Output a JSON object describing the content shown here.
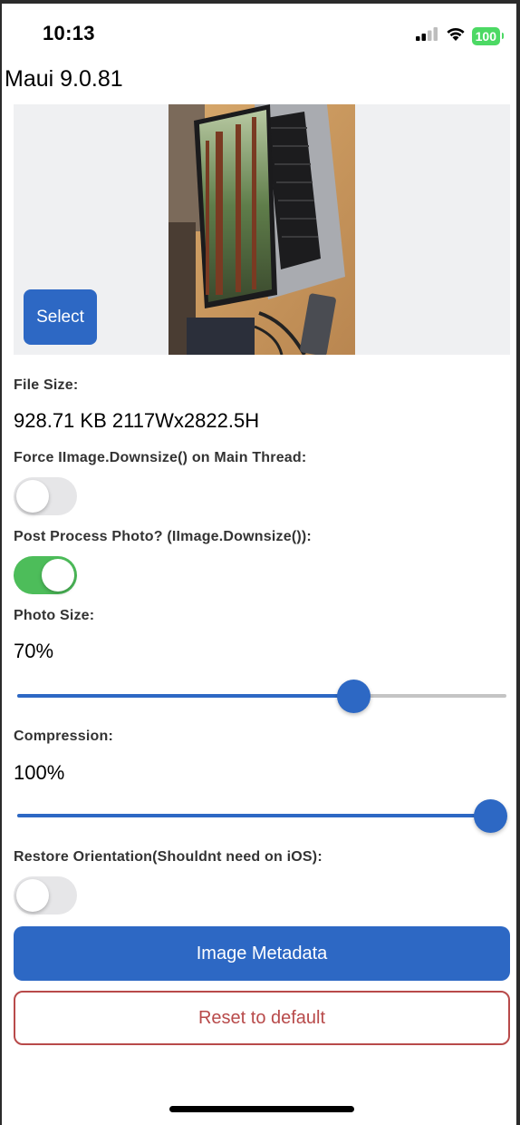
{
  "status_bar": {
    "time": "10:13",
    "battery": "100",
    "icons": [
      "cellular-signal-icon",
      "wifi-icon",
      "battery-icon"
    ]
  },
  "app": {
    "title": "Maui 9.0.81"
  },
  "image_panel": {
    "select_label": "Select"
  },
  "file_size": {
    "label": "File Size:",
    "value": "928.71 KB 2117Wx2822.5H"
  },
  "force_main_thread": {
    "label": "Force IImage.Downsize() on Main Thread:",
    "checked": false
  },
  "post_process": {
    "label": "Post Process Photo? (IImage.Downsize()):",
    "checked": true
  },
  "photo_size": {
    "label": "Photo Size:",
    "value_text": "70%",
    "value": 0.7
  },
  "compression": {
    "label": "Compression:",
    "value_text": "100%",
    "value": 1.0
  },
  "restore_orientation": {
    "label": "Restore Orientation(Shouldnt need on iOS):",
    "checked": false
  },
  "buttons": {
    "metadata_label": "Image Metadata",
    "reset_label": "Reset to default"
  },
  "colors": {
    "accent": "#2d68c4",
    "toggle_on": "#4dbd5a",
    "danger": "#b84a4a",
    "panel_bg": "#eff0f2"
  }
}
